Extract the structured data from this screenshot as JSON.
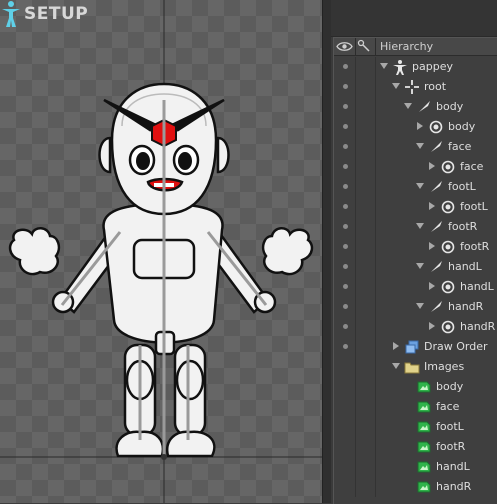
{
  "viewport": {
    "mode_label": "SETUP",
    "mode_icon": "person-pose-icon"
  },
  "panel": {
    "header": {
      "visibility_icon": "eye-icon",
      "bones_icon": "bone-link-icon",
      "title": "Hierarchy"
    },
    "tree": [
      {
        "label": "pappey",
        "icon": "skeleton-icon",
        "expanded": true
      },
      {
        "label": "root",
        "icon": "root-bone-icon",
        "expanded": true
      },
      {
        "label": "body",
        "icon": "bone-icon",
        "expanded": true
      },
      {
        "label": "body",
        "icon": "slot-icon",
        "expanded": false
      },
      {
        "label": "face",
        "icon": "bone-icon",
        "expanded": true
      },
      {
        "label": "face",
        "icon": "slot-icon",
        "expanded": false
      },
      {
        "label": "footL",
        "icon": "bone-icon",
        "expanded": true
      },
      {
        "label": "footL",
        "icon": "slot-icon",
        "expanded": false
      },
      {
        "label": "footR",
        "icon": "bone-icon",
        "expanded": true
      },
      {
        "label": "footR",
        "icon": "slot-icon",
        "expanded": false
      },
      {
        "label": "handL",
        "icon": "bone-icon",
        "expanded": true
      },
      {
        "label": "handL",
        "icon": "slot-icon",
        "expanded": false
      },
      {
        "label": "handR",
        "icon": "bone-icon",
        "expanded": true
      },
      {
        "label": "handR",
        "icon": "slot-icon",
        "expanded": false
      },
      {
        "label": "Draw Order",
        "icon": "draw-order-icon",
        "expanded": false
      },
      {
        "label": "Images",
        "icon": "folder-icon",
        "expanded": true
      },
      {
        "label": "body",
        "icon": "image-icon"
      },
      {
        "label": "face",
        "icon": "image-icon"
      },
      {
        "label": "footL",
        "icon": "image-icon"
      },
      {
        "label": "footR",
        "icon": "image-icon"
      },
      {
        "label": "handL",
        "icon": "image-icon"
      },
      {
        "label": "handR",
        "icon": "image-icon"
      }
    ]
  }
}
